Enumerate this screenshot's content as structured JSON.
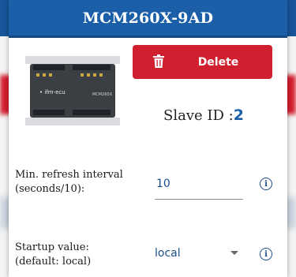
{
  "dialog": {
    "title": "MCM260X-9AD"
  },
  "device_image": {
    "logo": "• ifm-ecu",
    "label": "MCM260X"
  },
  "delete_button": {
    "label": "Delete",
    "icon": "trash-icon"
  },
  "slave": {
    "label": "Slave ID :",
    "value": "2"
  },
  "refresh": {
    "label_line1": "Min. refresh interval",
    "label_line2": "(seconds/10):",
    "value": "10",
    "info_icon": "info-icon"
  },
  "startup": {
    "label_line1": "Startup value:",
    "label_line2": "(default: local)",
    "selected": "local",
    "info_icon": "info-icon"
  },
  "colors": {
    "header": "#1b5fa9",
    "delete": "#d0202f",
    "accent": "#1b4f8c"
  }
}
